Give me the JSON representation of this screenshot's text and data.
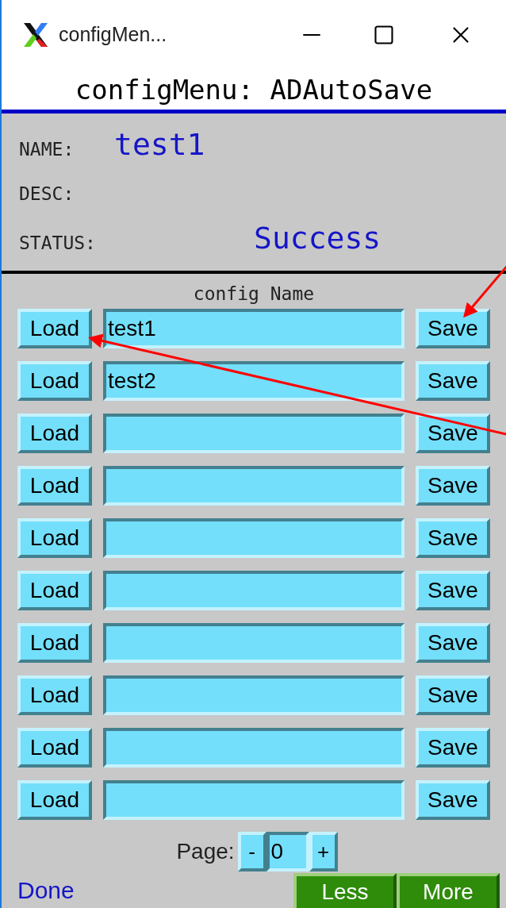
{
  "window": {
    "title": "configMen..."
  },
  "header": "configMenu: ADAutoSave",
  "info": [
    {
      "label": "NAME:",
      "value": "test1",
      "kind": "name"
    },
    {
      "label": "DESC:",
      "kind": "name"
    },
    {
      "label": "STATUS:",
      "value": "Success",
      "kind": "status"
    }
  ],
  "config_heading": "config Name",
  "configs": [
    {
      "load": "Load",
      "value": "test1",
      "save": "Save"
    },
    {
      "load": "Load",
      "value": "test2",
      "save": "Save"
    },
    {
      "load": "Load",
      "save": "Save"
    },
    {
      "load": "Load",
      "save": "Save"
    },
    {
      "load": "Load",
      "save": "Save"
    },
    {
      "load": "Load",
      "save": "Save"
    },
    {
      "load": "Load",
      "save": "Save"
    },
    {
      "load": "Load",
      "save": "Save"
    },
    {
      "load": "Load",
      "save": "Save"
    },
    {
      "load": "Load",
      "save": "Save"
    }
  ],
  "page": {
    "label": "Page:",
    "minus": "-",
    "value": "0",
    "plus": "+"
  },
  "status_bar": {
    "text": "Done",
    "buttons": [
      "Less",
      "More"
    ]
  }
}
